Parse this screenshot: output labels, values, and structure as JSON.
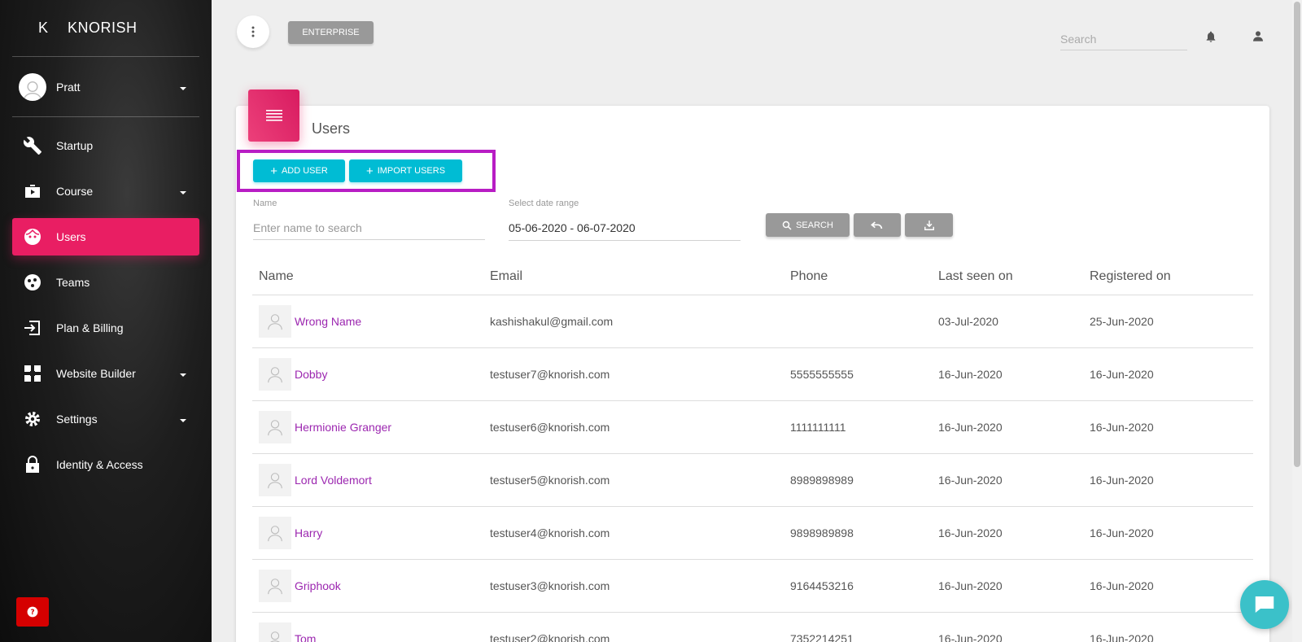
{
  "brand": {
    "mini": "K",
    "name": "KNORISH"
  },
  "user": {
    "name": "Pratt"
  },
  "sidebar": {
    "items": [
      {
        "label": "Startup",
        "icon": "wrench-icon"
      },
      {
        "label": "Course",
        "icon": "briefcase-icon"
      },
      {
        "label": "Users",
        "icon": "face-icon",
        "active": true
      },
      {
        "label": "Teams",
        "icon": "team-icon"
      },
      {
        "label": "Plan & Billing",
        "icon": "exit-icon"
      },
      {
        "label": "Website Builder",
        "icon": "widgets-icon"
      },
      {
        "label": "Settings",
        "icon": "gear-icon"
      },
      {
        "label": "Identity & Access",
        "icon": "lock-icon"
      }
    ]
  },
  "topbar": {
    "plan_label": "ENTERPRISE",
    "search_placeholder": "Search"
  },
  "page": {
    "title": "Users",
    "add_user_label": "ADD USER",
    "import_users_label": "IMPORT USERS",
    "name_label": "Name",
    "name_placeholder": "Enter name to search",
    "date_label": "Select date range",
    "date_value": "05-06-2020 - 06-07-2020",
    "search_label": "SEARCH"
  },
  "table": {
    "headers": [
      "Name",
      "Email",
      "Phone",
      "Last seen on",
      "Registered on"
    ],
    "rows": [
      {
        "name": "Wrong Name",
        "email": "kashishakul@gmail.com",
        "phone": "",
        "last_seen": "03-Jul-2020",
        "registered": "25-Jun-2020"
      },
      {
        "name": "Dobby",
        "email": "testuser7@knorish.com",
        "phone": "5555555555",
        "last_seen": "16-Jun-2020",
        "registered": "16-Jun-2020"
      },
      {
        "name": "Hermionie Granger",
        "email": "testuser6@knorish.com",
        "phone": "1111111111",
        "last_seen": "16-Jun-2020",
        "registered": "16-Jun-2020"
      },
      {
        "name": "Lord Voldemort",
        "email": "testuser5@knorish.com",
        "phone": "8989898989",
        "last_seen": "16-Jun-2020",
        "registered": "16-Jun-2020"
      },
      {
        "name": "Harry",
        "email": "testuser4@knorish.com",
        "phone": "9898989898",
        "last_seen": "16-Jun-2020",
        "registered": "16-Jun-2020"
      },
      {
        "name": "Griphook",
        "email": "testuser3@knorish.com",
        "phone": "9164453216",
        "last_seen": "16-Jun-2020",
        "registered": "16-Jun-2020"
      },
      {
        "name": "Tom",
        "email": "testuser2@knorish.com",
        "phone": "7352214251",
        "last_seen": "16-Jun-2020",
        "registered": "16-Jun-2020"
      }
    ]
  },
  "colors": {
    "accent": "#e91e63",
    "cyan": "#00bcd4",
    "link": "#9c27b0",
    "highlight": "#b81dc4"
  }
}
